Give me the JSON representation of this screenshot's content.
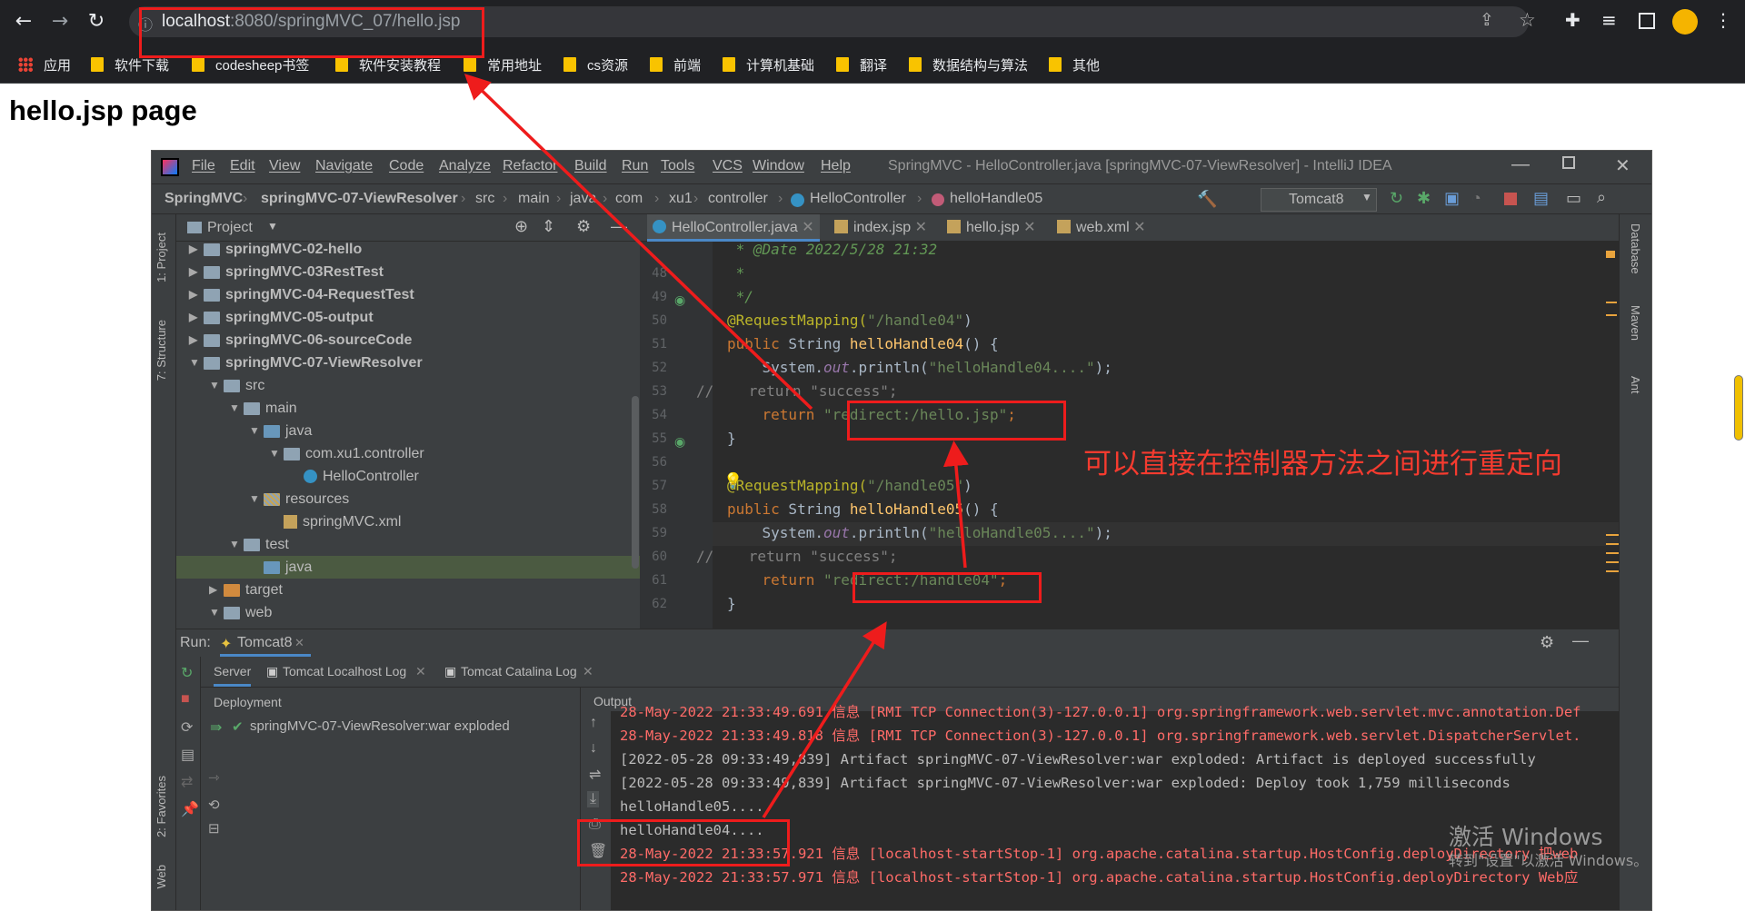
{
  "browser": {
    "url_host": "localhost",
    "url_rest": ":8080/springMVC_07/hello.jsp",
    "bookmarks": [
      "应用",
      "软件下载",
      "codesheep书签",
      "软件安装教程",
      "常用地址",
      "cs资源",
      "前端",
      "计算机基础",
      "翻译",
      "数据结构与算法",
      "其他"
    ]
  },
  "page": {
    "title": "hello.jsp page"
  },
  "ide": {
    "menu": [
      "File",
      "Edit",
      "View",
      "Navigate",
      "Code",
      "Analyze",
      "Refactor",
      "Build",
      "Run",
      "Tools",
      "VCS",
      "Window",
      "Help"
    ],
    "window_title": "SpringMVC - HelloController.java [springMVC-07-ViewResolver] - IntelliJ IDEA",
    "breadcrumbs": [
      "SpringMVC",
      "springMVC-07-ViewResolver",
      "src",
      "main",
      "java",
      "com",
      "xu1",
      "controller",
      "HelloController",
      "helloHandle05"
    ],
    "run_config": "Tomcat8",
    "left_tabs": [
      "1: Project",
      "7: Structure",
      "2: Favorites",
      "Web"
    ],
    "right_tabs": [
      "Database",
      "Maven",
      "Ant"
    ],
    "project_label": "Project",
    "tree": [
      {
        "label": "springMVC-02-hello",
        "level": 0,
        "type": "module",
        "open": false
      },
      {
        "label": "springMVC-03RestTest",
        "level": 0,
        "type": "module",
        "open": false
      },
      {
        "label": "springMVC-04-RequestTest",
        "level": 0,
        "type": "module",
        "open": false
      },
      {
        "label": "springMVC-05-output",
        "level": 0,
        "type": "module",
        "open": false
      },
      {
        "label": "springMVC-06-sourceCode",
        "level": 0,
        "type": "module",
        "open": false
      },
      {
        "label": "springMVC-07-ViewResolver",
        "level": 0,
        "type": "module",
        "open": true
      },
      {
        "label": "src",
        "level": 1,
        "type": "folder",
        "open": true
      },
      {
        "label": "main",
        "level": 2,
        "type": "folder",
        "open": true
      },
      {
        "label": "java",
        "level": 3,
        "type": "srcfolder",
        "open": true
      },
      {
        "label": "com.xu1.controller",
        "level": 4,
        "type": "package",
        "open": true
      },
      {
        "label": "HelloController",
        "level": 5,
        "type": "class",
        "open": null
      },
      {
        "label": "resources",
        "level": 3,
        "type": "resfolder",
        "open": true
      },
      {
        "label": "springMVC.xml",
        "level": 4,
        "type": "xml",
        "open": null
      },
      {
        "label": "test",
        "level": 2,
        "type": "folder",
        "open": true
      },
      {
        "label": "java",
        "level": 3,
        "type": "srcfolder",
        "open": null
      },
      {
        "label": "target",
        "level": 1,
        "type": "target",
        "open": false
      },
      {
        "label": "web",
        "level": 1,
        "type": "folder",
        "open": true
      }
    ],
    "tabs": [
      "HelloController.java",
      "index.jsp",
      "hello.jsp",
      "web.xml"
    ],
    "line_numbers": [
      "48",
      "49",
      "50",
      "51",
      "52",
      "53",
      "54",
      "55",
      "56",
      "57",
      "58",
      "59",
      "60",
      "61",
      "62"
    ],
    "code": {
      "l47": " * @Date 2022/5/28 21:32",
      "l49": " */",
      "l50_ann": "@RequestMapping(",
      "l50_str": "\"/handle04\"",
      "l51_kw": "public",
      "l51_type": " String ",
      "l51_fn": "helloHandle04",
      "l51_end": "() {",
      "l52_a": "    System.",
      "l52_out": "out",
      "l52_b": ".println(",
      "l52_str": "\"helloHandle04....\"",
      "l52_end": ");",
      "l53_cm": "//",
      "l53_rest": "    return \"success\";",
      "l54_kw": "    return ",
      "l54_str": "\"redirect:/hello.jsp\"",
      "l54_end": ";",
      "l55": "}",
      "l57_ann": "@RequestMapping(",
      "l57_str": "\"/handle05\"",
      "l58_kw": "public",
      "l58_type": " String ",
      "l58_fn": "helloHandle05",
      "l58_end": "() {",
      "l59_a": "    System.",
      "l59_out": "out",
      "l59_b": ".println(",
      "l59_str": "\"helloHandle05....\"",
      "l59_end": ");",
      "l60_cm": "//",
      "l60_rest": "    return \"success\";",
      "l61_kw": "    return ",
      "l61_str": "\"redirect:/handle04\"",
      "l61_end": ";",
      "l62": "}"
    },
    "run": {
      "label": "Run:",
      "config": "Tomcat8",
      "tabs": [
        "Server",
        "Tomcat Localhost Log",
        "Tomcat Catalina Log"
      ],
      "deployment_header": "Deployment",
      "output_header": "Output",
      "artifact": "springMVC-07-ViewResolver:war exploded",
      "output": [
        {
          "text": "28-May-2022 21:33:49.691 信息 [RMI TCP Connection(3)-127.0.0.1] org.springframework.web.servlet.mvc.annotation.Def",
          "red": true
        },
        {
          "text": "28-May-2022 21:33:49.818 信息 [RMI TCP Connection(3)-127.0.0.1] org.springframework.web.servlet.DispatcherServlet.",
          "red": true
        },
        {
          "text": "[2022-05-28 09:33:49,839] Artifact springMVC-07-ViewResolver:war exploded: Artifact is deployed successfully",
          "red": false
        },
        {
          "text": "[2022-05-28 09:33:49,839] Artifact springMVC-07-ViewResolver:war exploded: Deploy took 1,759 milliseconds",
          "red": false
        },
        {
          "text": "helloHandle05....",
          "red": false
        },
        {
          "text": "helloHandle04....",
          "red": false
        },
        {
          "text": "28-May-2022 21:33:57.921 信息 [localhost-startStop-1] org.apache.catalina.startup.HostConfig.deployDirectory 把web",
          "red": true
        },
        {
          "text": "28-May-2022 21:33:57.971 信息 [localhost-startStop-1] org.apache.catalina.startup.HostConfig.deployDirectory Web应",
          "red": true
        }
      ]
    }
  },
  "annotation": {
    "text": "可以直接在控制器方法之间进行重定向",
    "color": "#ee1c1c"
  },
  "watermark": {
    "line1": "激活 Windows",
    "line2": "转到\"设置\"以激活 Windows。"
  }
}
